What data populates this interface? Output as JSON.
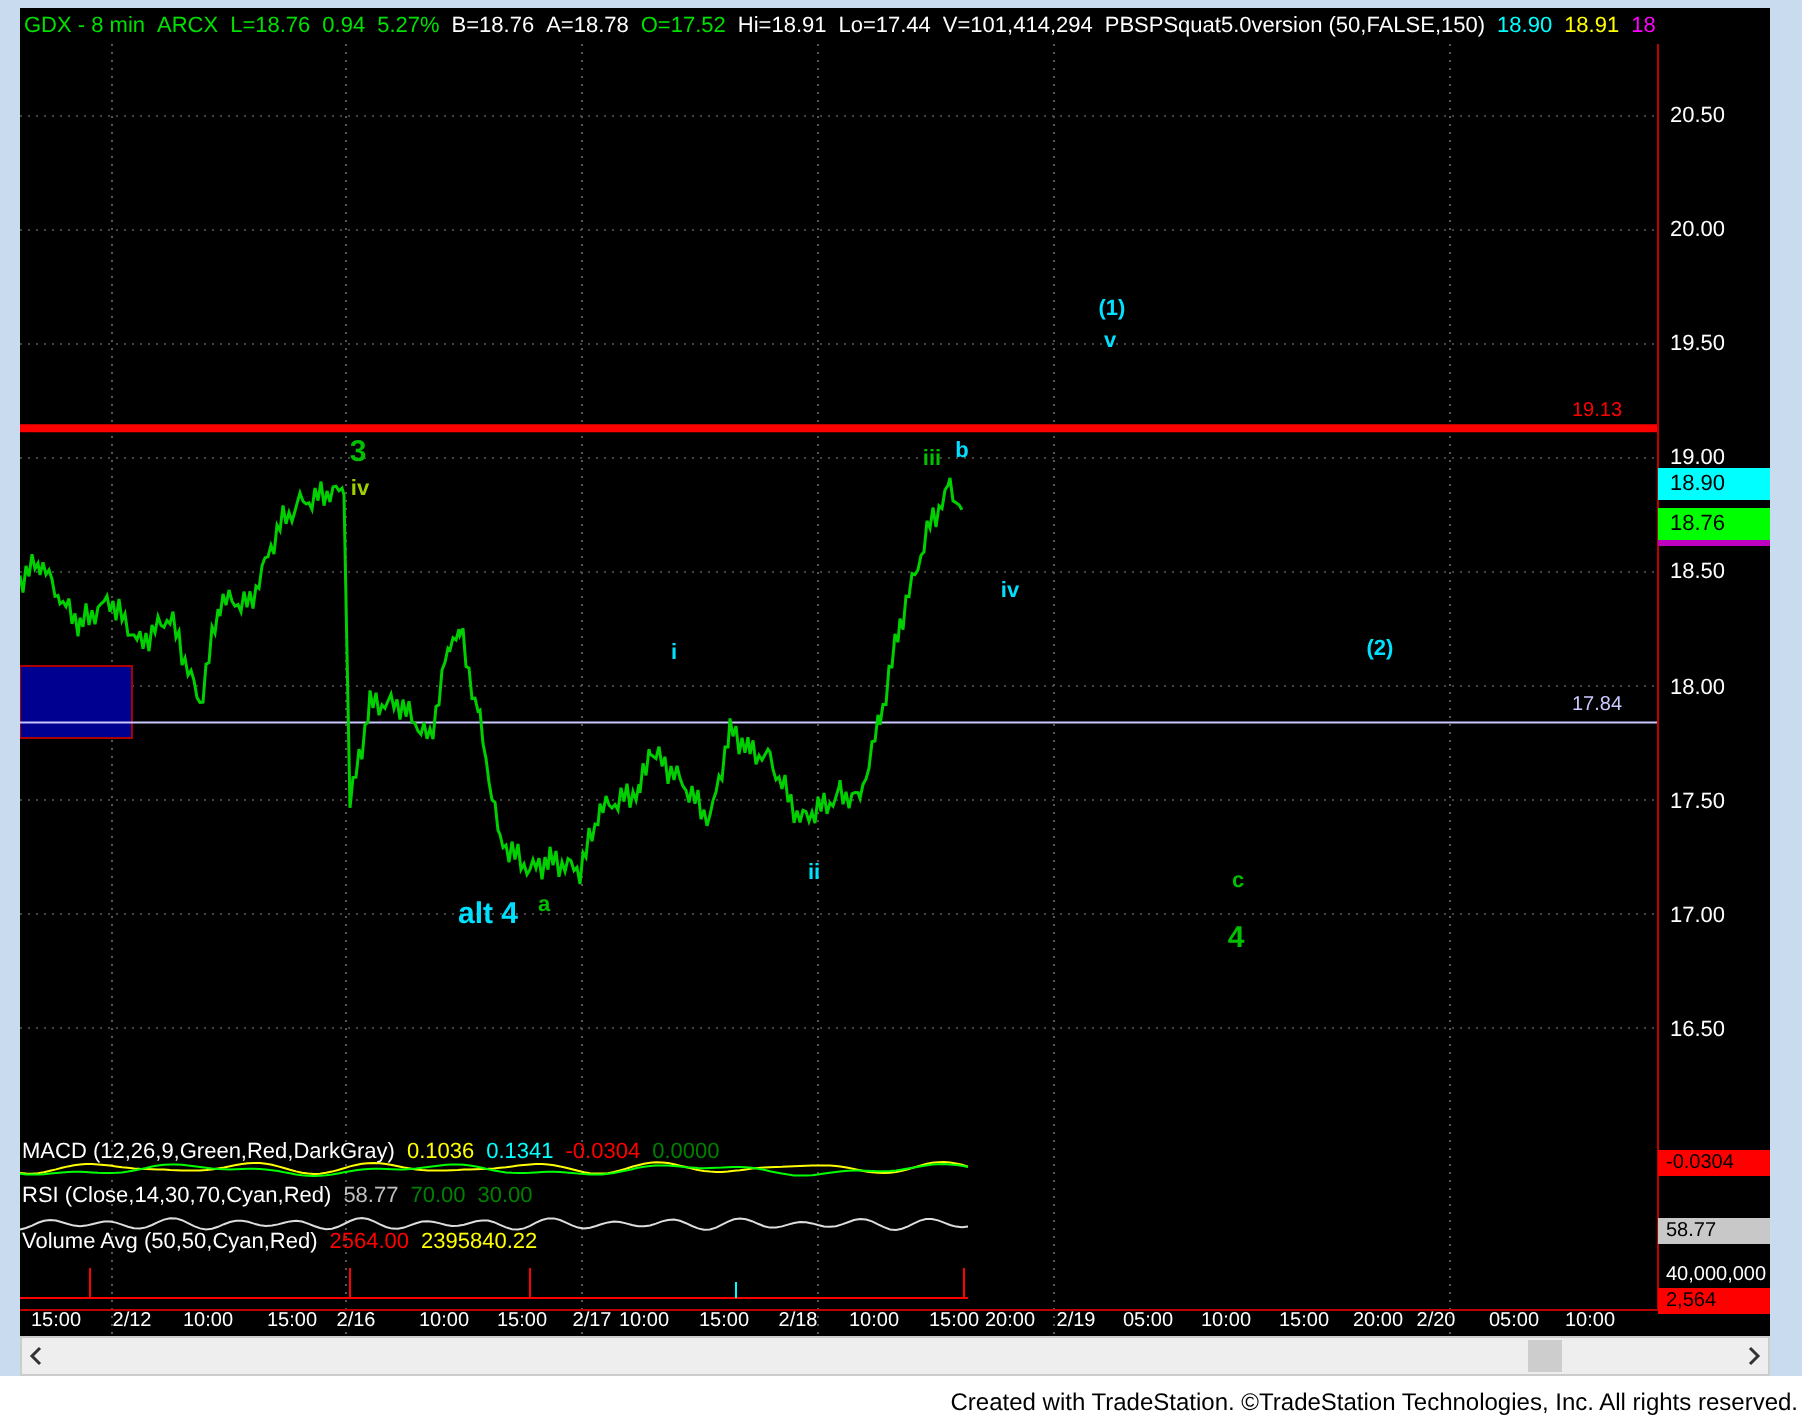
{
  "header": [
    {
      "text": "GDX - 8 min",
      "color": "#00e000"
    },
    {
      "text": "ARCX",
      "color": "#00e000"
    },
    {
      "text": "L=18.76",
      "color": "#00e000"
    },
    {
      "text": "0.94",
      "color": "#00e000"
    },
    {
      "text": "5.27%",
      "color": "#00e000"
    },
    {
      "text": "B=18.76",
      "color": "#ffffff"
    },
    {
      "text": "A=18.78",
      "color": "#ffffff"
    },
    {
      "text": "O=17.52",
      "color": "#00e000"
    },
    {
      "text": "Hi=18.91",
      "color": "#ffffff"
    },
    {
      "text": "Lo=17.44",
      "color": "#ffffff"
    },
    {
      "text": "V=101,414,294",
      "color": "#ffffff"
    },
    {
      "text": "PBSPSquat5.0version (50,FALSE,150)",
      "color": "#ffffff"
    },
    {
      "text": "18.90",
      "color": "#00ffff"
    },
    {
      "text": "18.91",
      "color": "#ffff00"
    },
    {
      "text": "18",
      "color": "#ff00ff"
    }
  ],
  "price_axis": [
    "20.50",
    "20.00",
    "19.50",
    "19.00",
    "18.50",
    "18.00",
    "17.50",
    "17.00",
    "16.50"
  ],
  "levels": [
    {
      "kind": "resistance",
      "label": "19.13",
      "color": "#ff0000"
    },
    {
      "kind": "support",
      "label": "17.84",
      "color": "#c8c8ff"
    }
  ],
  "price_badges": [
    {
      "text": "18.90",
      "color": "#00ffff"
    },
    {
      "text": "18.76",
      "color": "#00ff00"
    }
  ],
  "wave_labels": [
    {
      "text": "3",
      "kind": "major",
      "color": "#00c000"
    },
    {
      "text": "iv",
      "kind": "minor",
      "color": "#a0d000"
    },
    {
      "text": "alt 4",
      "kind": "major",
      "color": "#00e0ff"
    },
    {
      "text": "a",
      "kind": "minor",
      "color": "#00c000"
    },
    {
      "text": "i",
      "kind": "minor",
      "color": "#00e0ff"
    },
    {
      "text": "ii",
      "kind": "minor",
      "color": "#00e0ff"
    },
    {
      "text": "iii",
      "kind": "minor",
      "color": "#00c000"
    },
    {
      "text": "b",
      "kind": "minor",
      "color": "#00e0ff"
    },
    {
      "text": "iv",
      "kind": "minor",
      "color": "#00e0ff"
    },
    {
      "text": "(1)",
      "kind": "minor",
      "color": "#00e0ff"
    },
    {
      "text": "v",
      "kind": "minor",
      "color": "#00e0ff"
    },
    {
      "text": "(2)",
      "kind": "minor",
      "color": "#00e0ff"
    },
    {
      "text": "c",
      "kind": "minor",
      "color": "#00c000"
    },
    {
      "text": "4",
      "kind": "major",
      "color": "#00c000"
    }
  ],
  "indicators": [
    {
      "name": "MACD (12,26,9,Green,Red,DarkGray)",
      "values": [
        {
          "text": "0.1036",
          "color": "#ffff00"
        },
        {
          "text": "0.1341",
          "color": "#00ffff"
        },
        {
          "text": "-0.0304",
          "color": "#ff0000"
        },
        {
          "text": "0.0000",
          "color": "#008000"
        }
      ]
    },
    {
      "name": "RSI (Close,14,30,70,Cyan,Red)",
      "values": [
        {
          "text": "58.77",
          "color": "#c0c0c0"
        },
        {
          "text": "70.00",
          "color": "#008000"
        },
        {
          "text": "30.00",
          "color": "#008000"
        }
      ]
    },
    {
      "name": "Volume Avg (50,50,Cyan,Red)",
      "values": [
        {
          "text": "2564.00",
          "color": "#ff0000"
        },
        {
          "text": "2395840.22",
          "color": "#ffff00"
        }
      ]
    }
  ],
  "indicator_badges": [
    {
      "text": "-0.0304",
      "color": "#ff0000"
    },
    {
      "text": "58.77",
      "color": "#c8c8c8"
    },
    {
      "text": "40,000,000",
      "color": "#000000"
    },
    {
      "text": "2,564",
      "color": "#ff0000"
    }
  ],
  "time_axis": [
    "15:00",
    "2/12",
    "10:00",
    "15:00",
    "2/16",
    "10:00",
    "15:00",
    "2/17",
    "10:00",
    "15:00",
    "2/18",
    "10:00",
    "15:00",
    "20:00",
    "2/19",
    "05:00",
    "10:00",
    "15:00",
    "20:00",
    "2/20",
    "05:00",
    "10:00"
  ],
  "footer": "Created with TradeStation. ©TradeStation Technologies, Inc. All rights reserved."
}
